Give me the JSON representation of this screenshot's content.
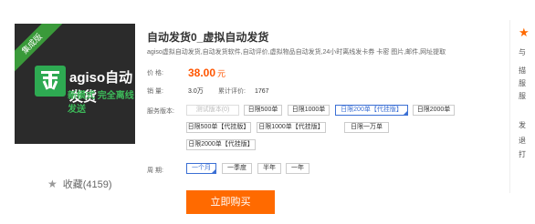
{
  "image": {
    "ribbon": "集成版",
    "brand": "agiso自动发货",
    "slogan": "新模式 完全离线发送"
  },
  "favorite": {
    "label": "收藏(4159)"
  },
  "product": {
    "title": "自动发货0_虚拟自动发货",
    "description": "agiso虚拟自动发货,自动发货软件,自动评价,虚拟物品自动发货,24小时离线发卡券 卡密 图片,邮件,网址提取"
  },
  "price": {
    "label": "价 格:",
    "value": "38.00",
    "unit": "元"
  },
  "sales": {
    "label": "销 量:",
    "value": "3.0万",
    "reviews_label": "累计评价:",
    "reviews_value": "1767"
  },
  "version": {
    "label": "服务版本:",
    "options": [
      {
        "text": "测试版本(0)",
        "disabled": true,
        "selected": false
      },
      {
        "text": "日限500单",
        "disabled": false,
        "selected": false
      },
      {
        "text": "日限1000单",
        "disabled": false,
        "selected": false
      },
      {
        "text": "日限200单【代挂版】",
        "disabled": false,
        "selected": true
      },
      {
        "text": "日限2000单",
        "disabled": false,
        "selected": false
      },
      {
        "text": "日限500单【代挂版】",
        "disabled": false,
        "selected": false
      },
      {
        "text": "日限1000单【代挂版】",
        "disabled": false,
        "selected": false
      },
      {
        "text": "日限一万单",
        "disabled": false,
        "selected": false
      },
      {
        "text": "日限2000单【代挂版】",
        "disabled": false,
        "selected": false
      }
    ]
  },
  "period": {
    "label": "周 期:",
    "options": [
      {
        "text": "一个月",
        "selected": true
      },
      {
        "text": "一季度",
        "selected": false
      },
      {
        "text": "半年",
        "selected": false
      },
      {
        "text": "一年",
        "selected": false
      }
    ]
  },
  "buy_button": {
    "label": "立即购买"
  },
  "side_panel": {
    "lines": [
      "与",
      "描",
      "服",
      "服",
      "发",
      "退",
      "打"
    ]
  },
  "colors": {
    "accent": "#ff6a00",
    "price": "#ff5500",
    "selected_border": "#3b6fd4"
  },
  "icons": {
    "favorite": "star-icon",
    "side": "star-icon",
    "logo": "agiso-logo-icon"
  }
}
